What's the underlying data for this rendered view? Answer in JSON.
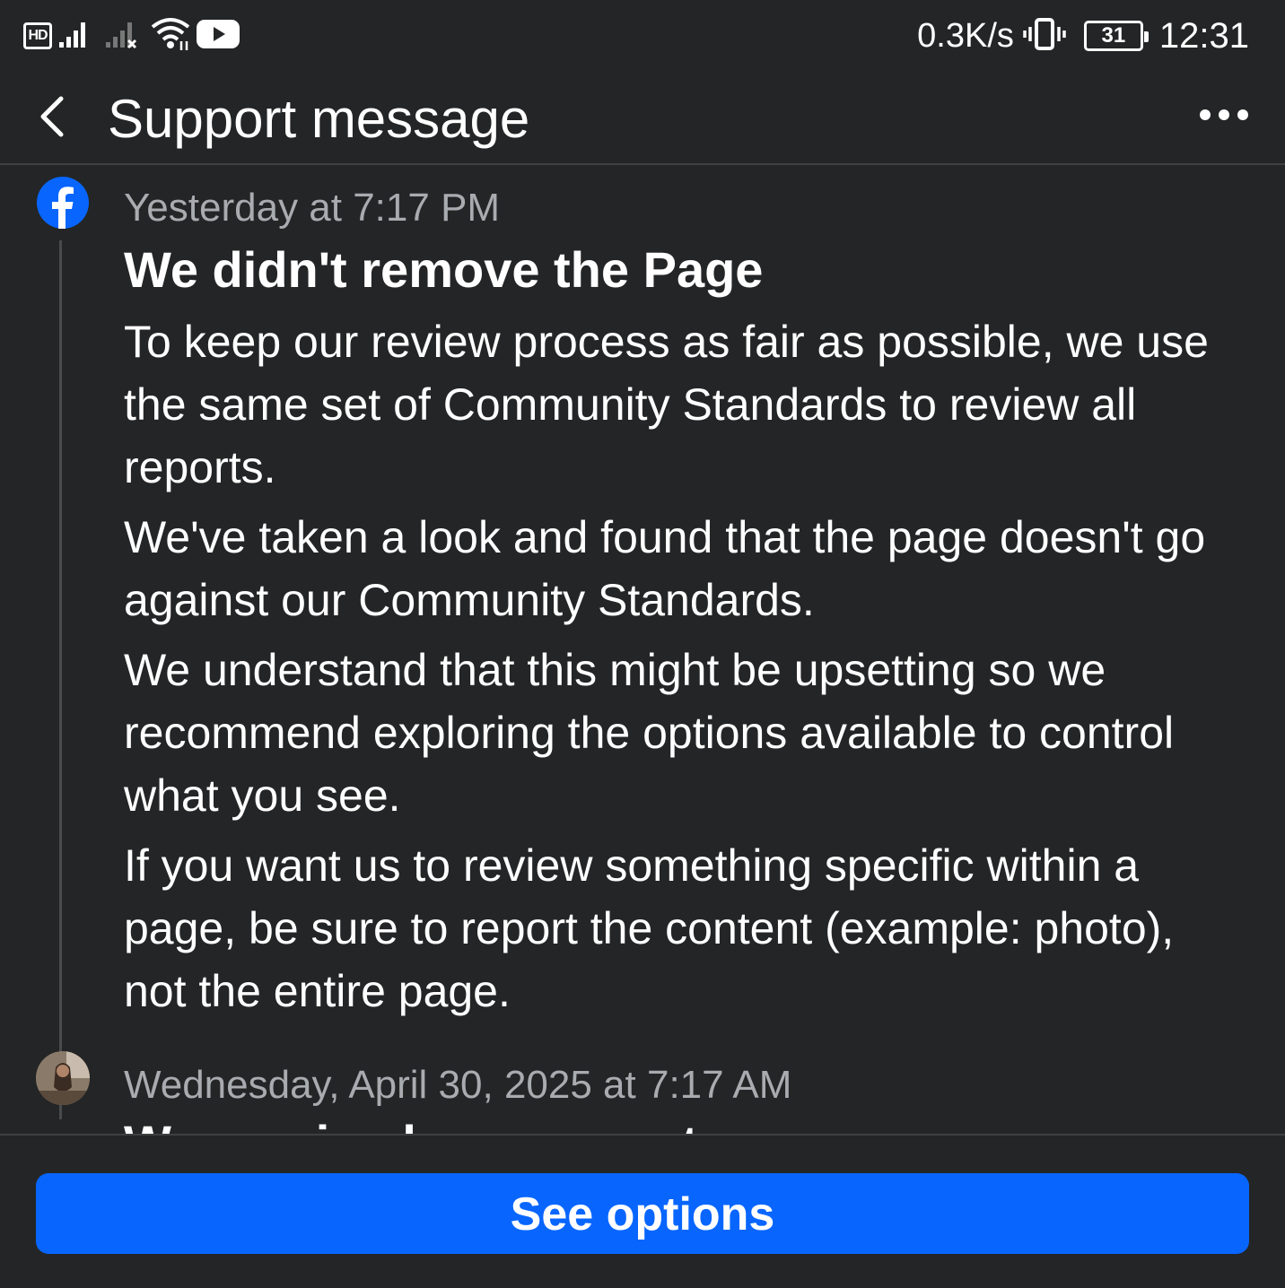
{
  "status_bar": {
    "hd_label": "HD",
    "net_speed": "0.3K/s",
    "battery_level": "31",
    "time": "12:31",
    "icons": [
      "signal-icon",
      "no-signal-icon",
      "wifi-icon",
      "youtube-icon",
      "vibrate-icon",
      "battery-icon"
    ]
  },
  "header": {
    "title": "Support message",
    "back_icon": "chevron-left-icon",
    "more_icon": "more-horizontal-icon"
  },
  "messages": [
    {
      "sender_icon": "facebook-logo-icon",
      "time": "Yesterday at 7:17 PM",
      "title": "We didn't remove the Page",
      "paragraphs": [
        "To keep our review process as fair as possible, we use the same set of Community Standards to review all reports.",
        "We've taken a look and found that the page doesn't go against our Community Standards.",
        "We understand that this might be upsetting so we recommend exploring the options available to control what you see.",
        "If you want us to review something specific within a page, be sure to report the content (example: photo), not the entire page."
      ]
    },
    {
      "sender_icon": "user-avatar",
      "time": "Wednesday, April 30, 2025 at 7:17 AM",
      "title": "We received your report"
    }
  ],
  "actions": {
    "see_options_label": "See options"
  },
  "colors": {
    "background": "#242526",
    "primary_button": "#0866ff",
    "secondary_text": "#a8abaf",
    "facebook_blue": "#0866ff"
  }
}
